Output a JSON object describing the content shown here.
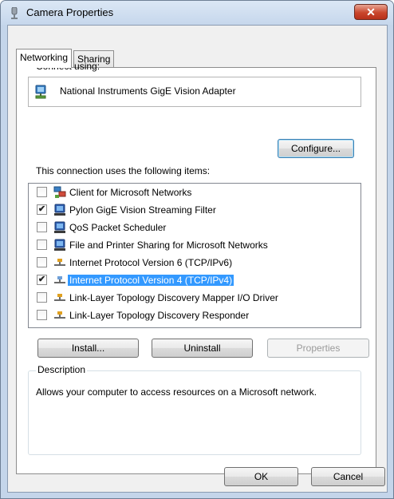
{
  "window": {
    "title": "Camera Properties"
  },
  "tabs": [
    {
      "label": "Networking",
      "active": true
    },
    {
      "label": "Sharing",
      "active": false
    }
  ],
  "connect": {
    "label": "Connect using:",
    "adapter": "National Instruments GigE Vision Adapter",
    "configure_label": "Configure..."
  },
  "items": {
    "label": "This connection uses the following items:",
    "list": [
      {
        "label": "Client for Microsoft Networks",
        "checked": false,
        "icon": "network-client-icon"
      },
      {
        "label": "Pylon GigE Vision Streaming Filter",
        "checked": true,
        "icon": "network-service-icon"
      },
      {
        "label": "QoS Packet Scheduler",
        "checked": false,
        "icon": "network-service-icon"
      },
      {
        "label": "File and Printer Sharing for Microsoft Networks",
        "checked": false,
        "icon": "network-service-icon"
      },
      {
        "label": "Internet Protocol Version 6 (TCP/IPv6)",
        "checked": false,
        "icon": "protocol-icon"
      },
      {
        "label": "Internet Protocol Version 4 (TCP/IPv4)",
        "checked": true,
        "icon": "protocol-icon",
        "selected": true
      },
      {
        "label": "Link-Layer Topology Discovery Mapper I/O Driver",
        "checked": false,
        "icon": "protocol-icon"
      },
      {
        "label": "Link-Layer Topology Discovery Responder",
        "checked": false,
        "icon": "protocol-icon"
      }
    ]
  },
  "actions": {
    "install": "Install...",
    "uninstall": "Uninstall",
    "properties": "Properties"
  },
  "description": {
    "legend": "Description",
    "text": "Allows your computer to access resources on a Microsoft network."
  },
  "footer": {
    "ok": "OK",
    "cancel": "Cancel"
  },
  "colors": {
    "selection": "#3399ff",
    "close_button": "#c9462c",
    "frame": "#c4d5ea"
  }
}
